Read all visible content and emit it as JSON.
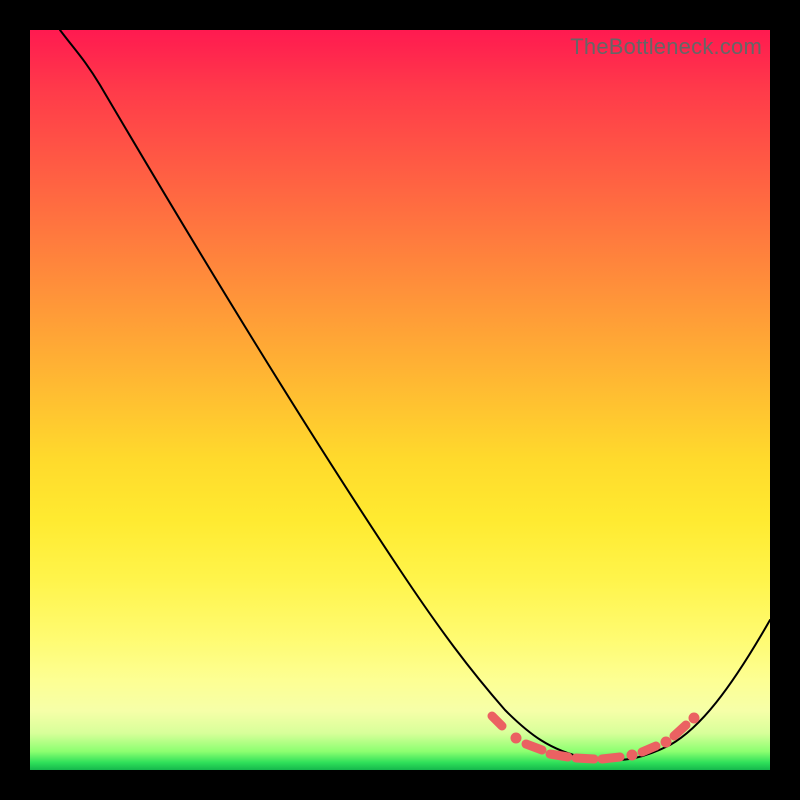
{
  "watermark": "TheBottleneck.com",
  "chart_data": {
    "type": "line",
    "title": "",
    "xlabel": "",
    "ylabel": "",
    "xlim": [
      0,
      100
    ],
    "ylim": [
      0,
      100
    ],
    "series": [
      {
        "name": "curve",
        "x": [
          4,
          8,
          12,
          20,
          30,
          40,
          50,
          58,
          62,
          65,
          68,
          70,
          73,
          76,
          79,
          82,
          85,
          88,
          92,
          96,
          100
        ],
        "y": [
          100,
          98,
          95,
          85,
          71,
          57,
          43,
          31,
          24,
          18,
          12,
          8,
          4,
          2,
          1,
          1,
          2,
          5,
          10,
          18,
          28
        ]
      }
    ],
    "markers": {
      "name": "highlight-dots",
      "color": "#eb6162",
      "x": [
        62,
        65,
        68,
        70,
        72,
        75,
        78,
        80,
        83,
        86,
        88
      ],
      "y": [
        7,
        5,
        3,
        2.5,
        2,
        1.5,
        1.5,
        1.8,
        3,
        5,
        7
      ]
    }
  }
}
